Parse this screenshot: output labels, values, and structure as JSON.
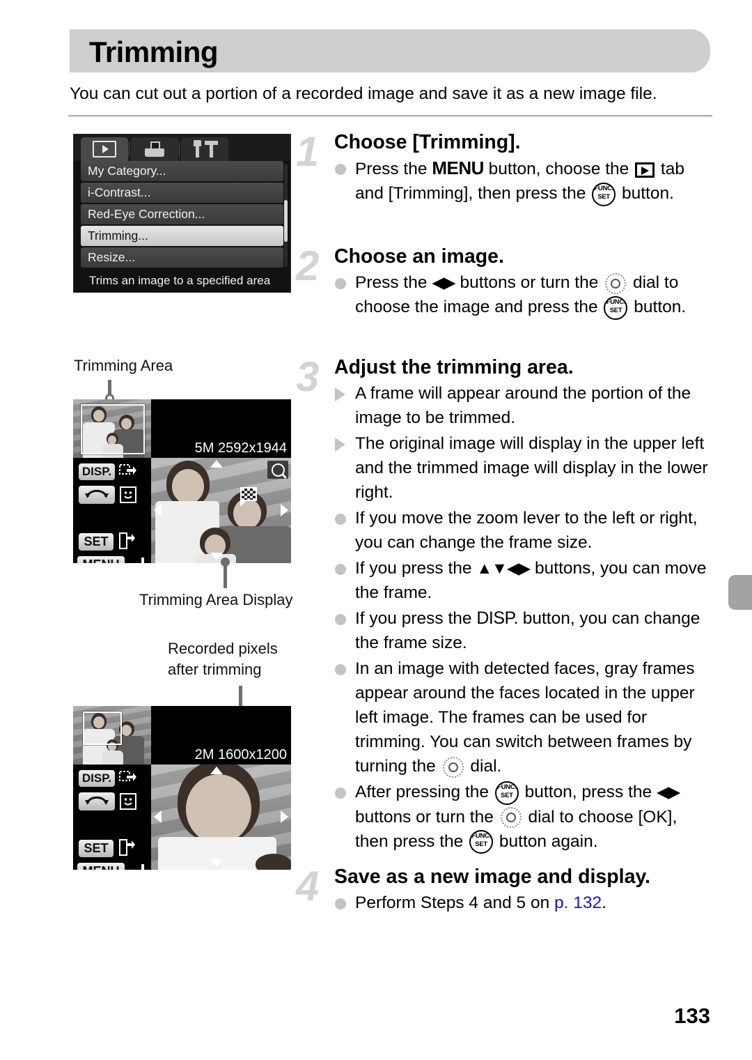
{
  "page": {
    "title": "Trimming",
    "subtitle": "You can cut out a portion of a recorded image and save it as a new image file.",
    "number": "133"
  },
  "menu_screenshot": {
    "tabs": [
      {
        "name": "playback-tab",
        "icon": "playback-icon",
        "active": true
      },
      {
        "name": "print-tab",
        "icon": "printer-icon",
        "active": false
      },
      {
        "name": "settings-tab",
        "icon": "tools-icon",
        "active": false
      }
    ],
    "items": [
      {
        "label": "My Category...",
        "selected": false
      },
      {
        "label": "i-Contrast...",
        "selected": false
      },
      {
        "label": "Red-Eye Correction...",
        "selected": false
      },
      {
        "label": "Trimming...",
        "selected": true
      },
      {
        "label": "Resize...",
        "selected": false
      }
    ],
    "help_text": "Trims an image to a specified area"
  },
  "figure_one": {
    "callout_top": "Trimming Area",
    "callout_bottom": "Trimming Area Display",
    "pixels_label": "5M 2592x1944",
    "controls": {
      "disp": "DISP.",
      "set": "SET",
      "menu": "MENU"
    }
  },
  "figure_two": {
    "callout": "Recorded pixels after trimming",
    "callout_line1": "Recorded pixels",
    "callout_line2": "after trimming",
    "pixels_label": "2M 1600x1200",
    "controls": {
      "disp": "DISP.",
      "set": "SET",
      "menu": "MENU"
    }
  },
  "steps": [
    {
      "number": "1",
      "heading": "Choose [Trimming].",
      "bullets": [
        {
          "type": "dot",
          "segments": [
            {
              "t": "text",
              "v": "Press the "
            },
            {
              "t": "icon",
              "v": "menu-button-icon",
              "label": "MENU"
            },
            {
              "t": "text",
              "v": " button, choose the "
            },
            {
              "t": "icon",
              "v": "playback-tab-icon"
            },
            {
              "t": "text",
              "v": " tab and [Trimming], then press the "
            },
            {
              "t": "icon",
              "v": "func-set-button-icon"
            },
            {
              "t": "text",
              "v": " button."
            }
          ]
        }
      ]
    },
    {
      "number": "2",
      "heading": "Choose an image.",
      "bullets": [
        {
          "type": "dot",
          "segments": [
            {
              "t": "text",
              "v": "Press the "
            },
            {
              "t": "icon",
              "v": "left-right-buttons-icon",
              "label": "◀▶"
            },
            {
              "t": "text",
              "v": " buttons or turn the "
            },
            {
              "t": "icon",
              "v": "control-dial-icon"
            },
            {
              "t": "text",
              "v": " dial to choose the image and press the "
            },
            {
              "t": "icon",
              "v": "func-set-button-icon"
            },
            {
              "t": "text",
              "v": " button."
            }
          ]
        }
      ]
    },
    {
      "number": "3",
      "heading": "Adjust the trimming area.",
      "bullets": [
        {
          "type": "triangle",
          "text": "A frame will appear around the portion of the image to be trimmed."
        },
        {
          "type": "triangle",
          "text": "The original image will display in the upper left and the trimmed image will display in the lower right."
        },
        {
          "type": "dot",
          "text": "If you move the zoom lever to the left or right, you can change the frame size."
        },
        {
          "type": "dot",
          "segments": [
            {
              "t": "text",
              "v": "If you press the "
            },
            {
              "t": "icon",
              "v": "four-way-buttons-icon",
              "label": "▲▼◀▶"
            },
            {
              "t": "text",
              "v": " buttons, you can move the frame."
            }
          ]
        },
        {
          "type": "dot",
          "segments": [
            {
              "t": "text",
              "v": "If you press the "
            },
            {
              "t": "icon",
              "v": "disp-button-icon",
              "label": "DISP."
            },
            {
              "t": "text",
              "v": " button, you can change the frame size."
            }
          ]
        },
        {
          "type": "dot",
          "segments": [
            {
              "t": "text",
              "v": "In an image with detected faces, gray frames appear around the faces located in the upper left image. The frames can be used for trimming. You can switch between frames by turning the "
            },
            {
              "t": "icon",
              "v": "control-dial-icon"
            },
            {
              "t": "text",
              "v": " dial."
            }
          ]
        },
        {
          "type": "dot",
          "segments": [
            {
              "t": "text",
              "v": "After pressing the "
            },
            {
              "t": "icon",
              "v": "func-set-button-icon"
            },
            {
              "t": "text",
              "v": " button, press the "
            },
            {
              "t": "icon",
              "v": "left-right-buttons-icon",
              "label": "◀▶"
            },
            {
              "t": "text",
              "v": " buttons or turn the "
            },
            {
              "t": "icon",
              "v": "control-dial-icon"
            },
            {
              "t": "text",
              "v": " dial to choose [OK], then press the "
            },
            {
              "t": "icon",
              "v": "func-set-button-icon"
            },
            {
              "t": "text",
              "v": " button again."
            }
          ]
        }
      ]
    },
    {
      "number": "4",
      "heading": "Save as a new image and display.",
      "bullets": [
        {
          "type": "dot",
          "segments": [
            {
              "t": "text",
              "v": "Perform Steps 4 and 5 on "
            },
            {
              "t": "link",
              "v": "p. 132"
            },
            {
              "t": "text",
              "v": "."
            }
          ]
        }
      ]
    }
  ],
  "step_text": {
    "s1_head": "Choose [Trimming].",
    "s1_a": "Press the ",
    "s1_b": " button, choose the ",
    "s1_c": " tab and [Trimming], then press the ",
    "s1_d": " button.",
    "s2_head": "Choose an image.",
    "s2_a": "Press the ",
    "s2_b": " buttons or turn the ",
    "s2_c": " dial to choose the image and press the ",
    "s2_d": " button.",
    "s3_head": "Adjust the trimming area.",
    "s3_b1": "A frame will appear around the portion of the image to be trimmed.",
    "s3_b2": "The original image will display in the upper left and the trimmed image will display in the lower right.",
    "s3_b3": "If you move the zoom lever to the left or right, you can change the frame size.",
    "s3_b4a": "If you press the ",
    "s3_b4b": " buttons, you can move the frame.",
    "s3_b5a": "If you press the ",
    "s3_b5b": " button, you can change the frame size.",
    "s3_b6a": "In an image with detected faces, gray frames appear around the faces located in the upper left image. The frames can be used for trimming. You can switch between frames by turning the ",
    "s3_b6b": " dial.",
    "s3_b7a": "After pressing the ",
    "s3_b7b": " button, press the ",
    "s3_b7c": " buttons or turn the ",
    "s3_b7d": " dial to choose ",
    "s3_b7e": "[OK], then press the ",
    "s3_b7f": " button again.",
    "s4_head": "Save as a new image and display.",
    "s4_a": "Perform Steps 4 and 5 on ",
    "s4_link": "p. 132",
    "s4_b": "."
  },
  "labels": {
    "menu_button": "MENU",
    "disp_button": "DISP.",
    "func_top": "FUNC.",
    "func_bottom": "SET",
    "lr_arrows": "◀▶",
    "four_arrows": "▲▼◀▶"
  },
  "colors": {
    "header_band": "#cfcfcf",
    "step_number": "#d3d3d3",
    "bullet": "#c3c3c3",
    "link": "#1414d8",
    "edge_tab": "#a3a3a3"
  }
}
